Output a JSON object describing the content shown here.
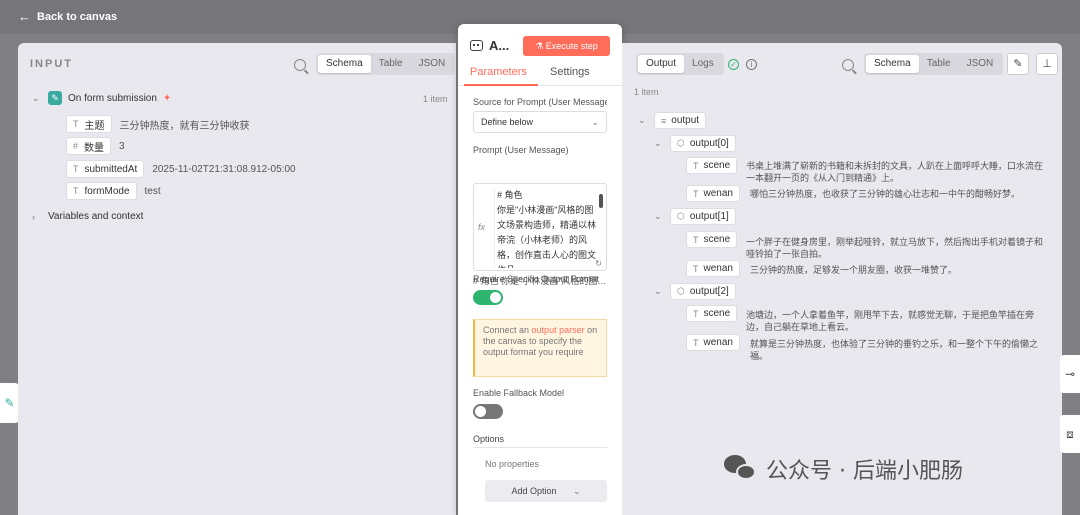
{
  "topbar": {
    "back_label": "Back to canvas"
  },
  "input_panel": {
    "title": "INPUT",
    "view_tabs": [
      "Schema",
      "Table",
      "JSON"
    ],
    "active_view": "Schema",
    "node_name": "On form submission",
    "item_count": "1 item",
    "fields": [
      {
        "type_icon": "T",
        "name": "主题",
        "value": "三分钟热度，就有三分钟收获"
      },
      {
        "type_icon": "#",
        "name": "数量",
        "value": "3"
      },
      {
        "type_icon": "T",
        "name": "submittedAt",
        "value": "2025-11-02T21:31:08.912-05:00"
      },
      {
        "type_icon": "T",
        "name": "formMode",
        "value": "test"
      }
    ],
    "variables_label": "Variables and context"
  },
  "node_modal": {
    "title": "A...",
    "execute_label": "Execute step",
    "tabs": [
      "Parameters",
      "Settings"
    ],
    "active_tab": "Parameters",
    "source_label": "Source for Prompt (User Message)",
    "source_value": "Define below",
    "prompt_label": "Prompt (User Message)",
    "prompt_text": "# 角色\n你是\"小林漫画\"风格的图文场景构造师，精通以林帝浣（小林老师）的风格，创作直击人心的图文作品。",
    "prompt_preview": "# 角色 你是\"小林漫画\"风格的图文场景构造师",
    "require_format_label": "Require Specific Output Format",
    "require_format_on": true,
    "hint_prefix": "Connect an ",
    "hint_highlight": "output parser",
    "hint_suffix": " on the canvas to specify the output format you require",
    "fallback_label": "Enable Fallback Model",
    "fallback_on": false,
    "options_label": "Options",
    "no_properties": "No properties",
    "add_option_label": "Add Option",
    "accent_color": "#ff6d5a",
    "toggle_on_color": "#2db46e"
  },
  "output_panel": {
    "tabs": [
      "Output",
      "Logs"
    ],
    "active_tab": "Output",
    "view_tabs": [
      "Schema",
      "Table",
      "JSON"
    ],
    "active_view": "Schema",
    "item_count": "1 item",
    "root": "output",
    "items": [
      {
        "label": "output[0]",
        "scene": "书桌上堆满了崭新的书籍和未拆封的文具，人趴在上面呼呼大睡，口水流在一本翻开一页的《从入门到精通》上。",
        "wenan": "哪怕三分钟热度，也收获了三分钟的雄心壮志和一中午的酣畅好梦。"
      },
      {
        "label": "output[1]",
        "scene": "一个胖子在健身房里，刚举起哑铃，就立马放下，然后掏出手机对着镜子和哑铃拍了一张自拍。",
        "wenan": "三分钟的热度，足够发一个朋友圈，收获一堆赞了。"
      },
      {
        "label": "output[2]",
        "scene": "池塘边，一个人拿着鱼竿，刚甩竿下去，就感觉无聊，于是把鱼竿插在旁边，自己躺在草地上看云。",
        "wenan": "就算是三分钟热度，也体验了三分钟的垂钓之乐，和一整个下午的偷懒之福。"
      }
    ],
    "field_scene": "scene",
    "field_wenan": "wenan"
  },
  "watermark": {
    "text": "公众号 · 后端小肥肠"
  }
}
